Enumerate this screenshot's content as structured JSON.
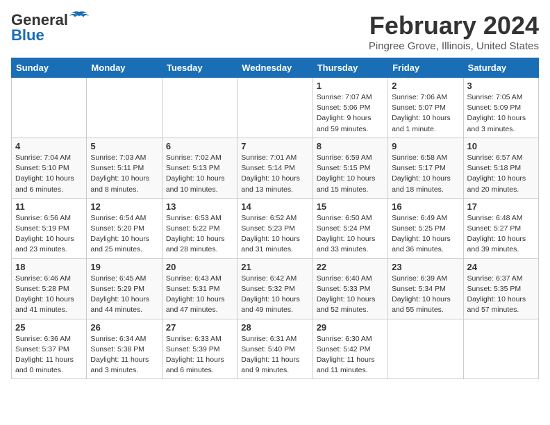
{
  "header": {
    "logo_general": "General",
    "logo_blue": "Blue",
    "month_title": "February 2024",
    "location": "Pingree Grove, Illinois, United States"
  },
  "days_of_week": [
    "Sunday",
    "Monday",
    "Tuesday",
    "Wednesday",
    "Thursday",
    "Friday",
    "Saturday"
  ],
  "weeks": [
    [
      {
        "day": "",
        "info": ""
      },
      {
        "day": "",
        "info": ""
      },
      {
        "day": "",
        "info": ""
      },
      {
        "day": "",
        "info": ""
      },
      {
        "day": "1",
        "info": "Sunrise: 7:07 AM\nSunset: 5:06 PM\nDaylight: 9 hours\nand 59 minutes."
      },
      {
        "day": "2",
        "info": "Sunrise: 7:06 AM\nSunset: 5:07 PM\nDaylight: 10 hours\nand 1 minute."
      },
      {
        "day": "3",
        "info": "Sunrise: 7:05 AM\nSunset: 5:09 PM\nDaylight: 10 hours\nand 3 minutes."
      }
    ],
    [
      {
        "day": "4",
        "info": "Sunrise: 7:04 AM\nSunset: 5:10 PM\nDaylight: 10 hours\nand 6 minutes."
      },
      {
        "day": "5",
        "info": "Sunrise: 7:03 AM\nSunset: 5:11 PM\nDaylight: 10 hours\nand 8 minutes."
      },
      {
        "day": "6",
        "info": "Sunrise: 7:02 AM\nSunset: 5:13 PM\nDaylight: 10 hours\nand 10 minutes."
      },
      {
        "day": "7",
        "info": "Sunrise: 7:01 AM\nSunset: 5:14 PM\nDaylight: 10 hours\nand 13 minutes."
      },
      {
        "day": "8",
        "info": "Sunrise: 6:59 AM\nSunset: 5:15 PM\nDaylight: 10 hours\nand 15 minutes."
      },
      {
        "day": "9",
        "info": "Sunrise: 6:58 AM\nSunset: 5:17 PM\nDaylight: 10 hours\nand 18 minutes."
      },
      {
        "day": "10",
        "info": "Sunrise: 6:57 AM\nSunset: 5:18 PM\nDaylight: 10 hours\nand 20 minutes."
      }
    ],
    [
      {
        "day": "11",
        "info": "Sunrise: 6:56 AM\nSunset: 5:19 PM\nDaylight: 10 hours\nand 23 minutes."
      },
      {
        "day": "12",
        "info": "Sunrise: 6:54 AM\nSunset: 5:20 PM\nDaylight: 10 hours\nand 25 minutes."
      },
      {
        "day": "13",
        "info": "Sunrise: 6:53 AM\nSunset: 5:22 PM\nDaylight: 10 hours\nand 28 minutes."
      },
      {
        "day": "14",
        "info": "Sunrise: 6:52 AM\nSunset: 5:23 PM\nDaylight: 10 hours\nand 31 minutes."
      },
      {
        "day": "15",
        "info": "Sunrise: 6:50 AM\nSunset: 5:24 PM\nDaylight: 10 hours\nand 33 minutes."
      },
      {
        "day": "16",
        "info": "Sunrise: 6:49 AM\nSunset: 5:25 PM\nDaylight: 10 hours\nand 36 minutes."
      },
      {
        "day": "17",
        "info": "Sunrise: 6:48 AM\nSunset: 5:27 PM\nDaylight: 10 hours\nand 39 minutes."
      }
    ],
    [
      {
        "day": "18",
        "info": "Sunrise: 6:46 AM\nSunset: 5:28 PM\nDaylight: 10 hours\nand 41 minutes."
      },
      {
        "day": "19",
        "info": "Sunrise: 6:45 AM\nSunset: 5:29 PM\nDaylight: 10 hours\nand 44 minutes."
      },
      {
        "day": "20",
        "info": "Sunrise: 6:43 AM\nSunset: 5:31 PM\nDaylight: 10 hours\nand 47 minutes."
      },
      {
        "day": "21",
        "info": "Sunrise: 6:42 AM\nSunset: 5:32 PM\nDaylight: 10 hours\nand 49 minutes."
      },
      {
        "day": "22",
        "info": "Sunrise: 6:40 AM\nSunset: 5:33 PM\nDaylight: 10 hours\nand 52 minutes."
      },
      {
        "day": "23",
        "info": "Sunrise: 6:39 AM\nSunset: 5:34 PM\nDaylight: 10 hours\nand 55 minutes."
      },
      {
        "day": "24",
        "info": "Sunrise: 6:37 AM\nSunset: 5:35 PM\nDaylight: 10 hours\nand 57 minutes."
      }
    ],
    [
      {
        "day": "25",
        "info": "Sunrise: 6:36 AM\nSunset: 5:37 PM\nDaylight: 11 hours\nand 0 minutes."
      },
      {
        "day": "26",
        "info": "Sunrise: 6:34 AM\nSunset: 5:38 PM\nDaylight: 11 hours\nand 3 minutes."
      },
      {
        "day": "27",
        "info": "Sunrise: 6:33 AM\nSunset: 5:39 PM\nDaylight: 11 hours\nand 6 minutes."
      },
      {
        "day": "28",
        "info": "Sunrise: 6:31 AM\nSunset: 5:40 PM\nDaylight: 11 hours\nand 9 minutes."
      },
      {
        "day": "29",
        "info": "Sunrise: 6:30 AM\nSunset: 5:42 PM\nDaylight: 11 hours\nand 11 minutes."
      },
      {
        "day": "",
        "info": ""
      },
      {
        "day": "",
        "info": ""
      }
    ]
  ]
}
